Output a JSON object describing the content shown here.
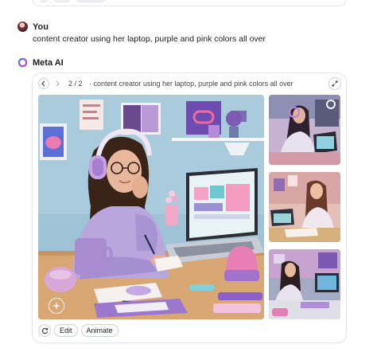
{
  "user_message": {
    "name": "You",
    "text": "content creator using her laptop, purple and pink colors all over"
  },
  "ai_response": {
    "name": "Meta AI",
    "counter": "2 / 2",
    "caption": "· content creator using her laptop, purple and pink colors all over",
    "actions": {
      "edit_label": "Edit",
      "animate_label": "Animate"
    }
  },
  "icons": {
    "prev": "chevron-left-icon",
    "next": "chevron-right-icon",
    "expand": "expand-icon",
    "regenerate": "refresh-icon",
    "watermark": "sparkle-icon",
    "ai_logo": "meta-ai-logo-icon"
  },
  "colors": {
    "accent_purple": "#8b5cf6",
    "accent_pink": "#e87fb4",
    "wall_blue": "#a9c8d8",
    "text": "#1c1e21",
    "border": "#e4e6eb"
  }
}
